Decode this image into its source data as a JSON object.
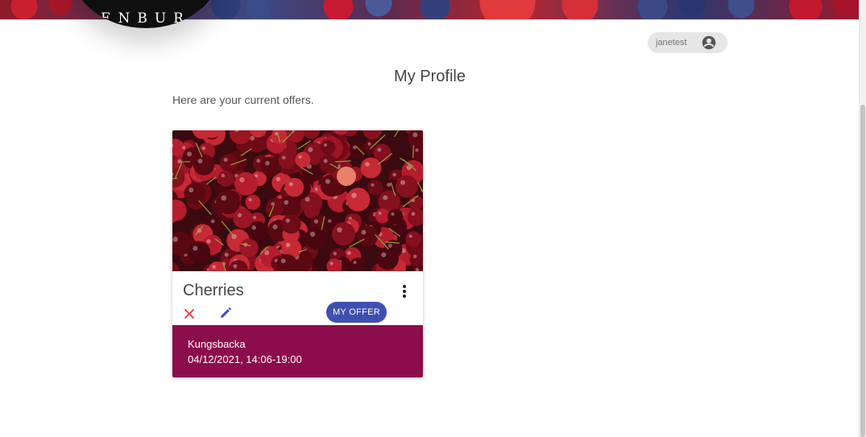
{
  "header": {
    "logo_text": "ENBUR"
  },
  "user": {
    "name": "janetest",
    "icon": "account-circle-icon"
  },
  "page": {
    "title": "My Profile",
    "subtitle": "Here are your current offers."
  },
  "offers": [
    {
      "title": "Cherries",
      "image": "cherries-photo",
      "badge_label": "MY OFFER",
      "location": "Kungsbacka",
      "datetime": "04/12/2021, 14:06-19:00",
      "actions": {
        "delete_icon": "close-icon",
        "edit_icon": "pencil-icon",
        "more_icon": "more-vert-icon"
      }
    }
  ],
  "colors": {
    "accent": "#3f4fb0",
    "footer": "#8b0d4b",
    "delete": "#e53935"
  }
}
